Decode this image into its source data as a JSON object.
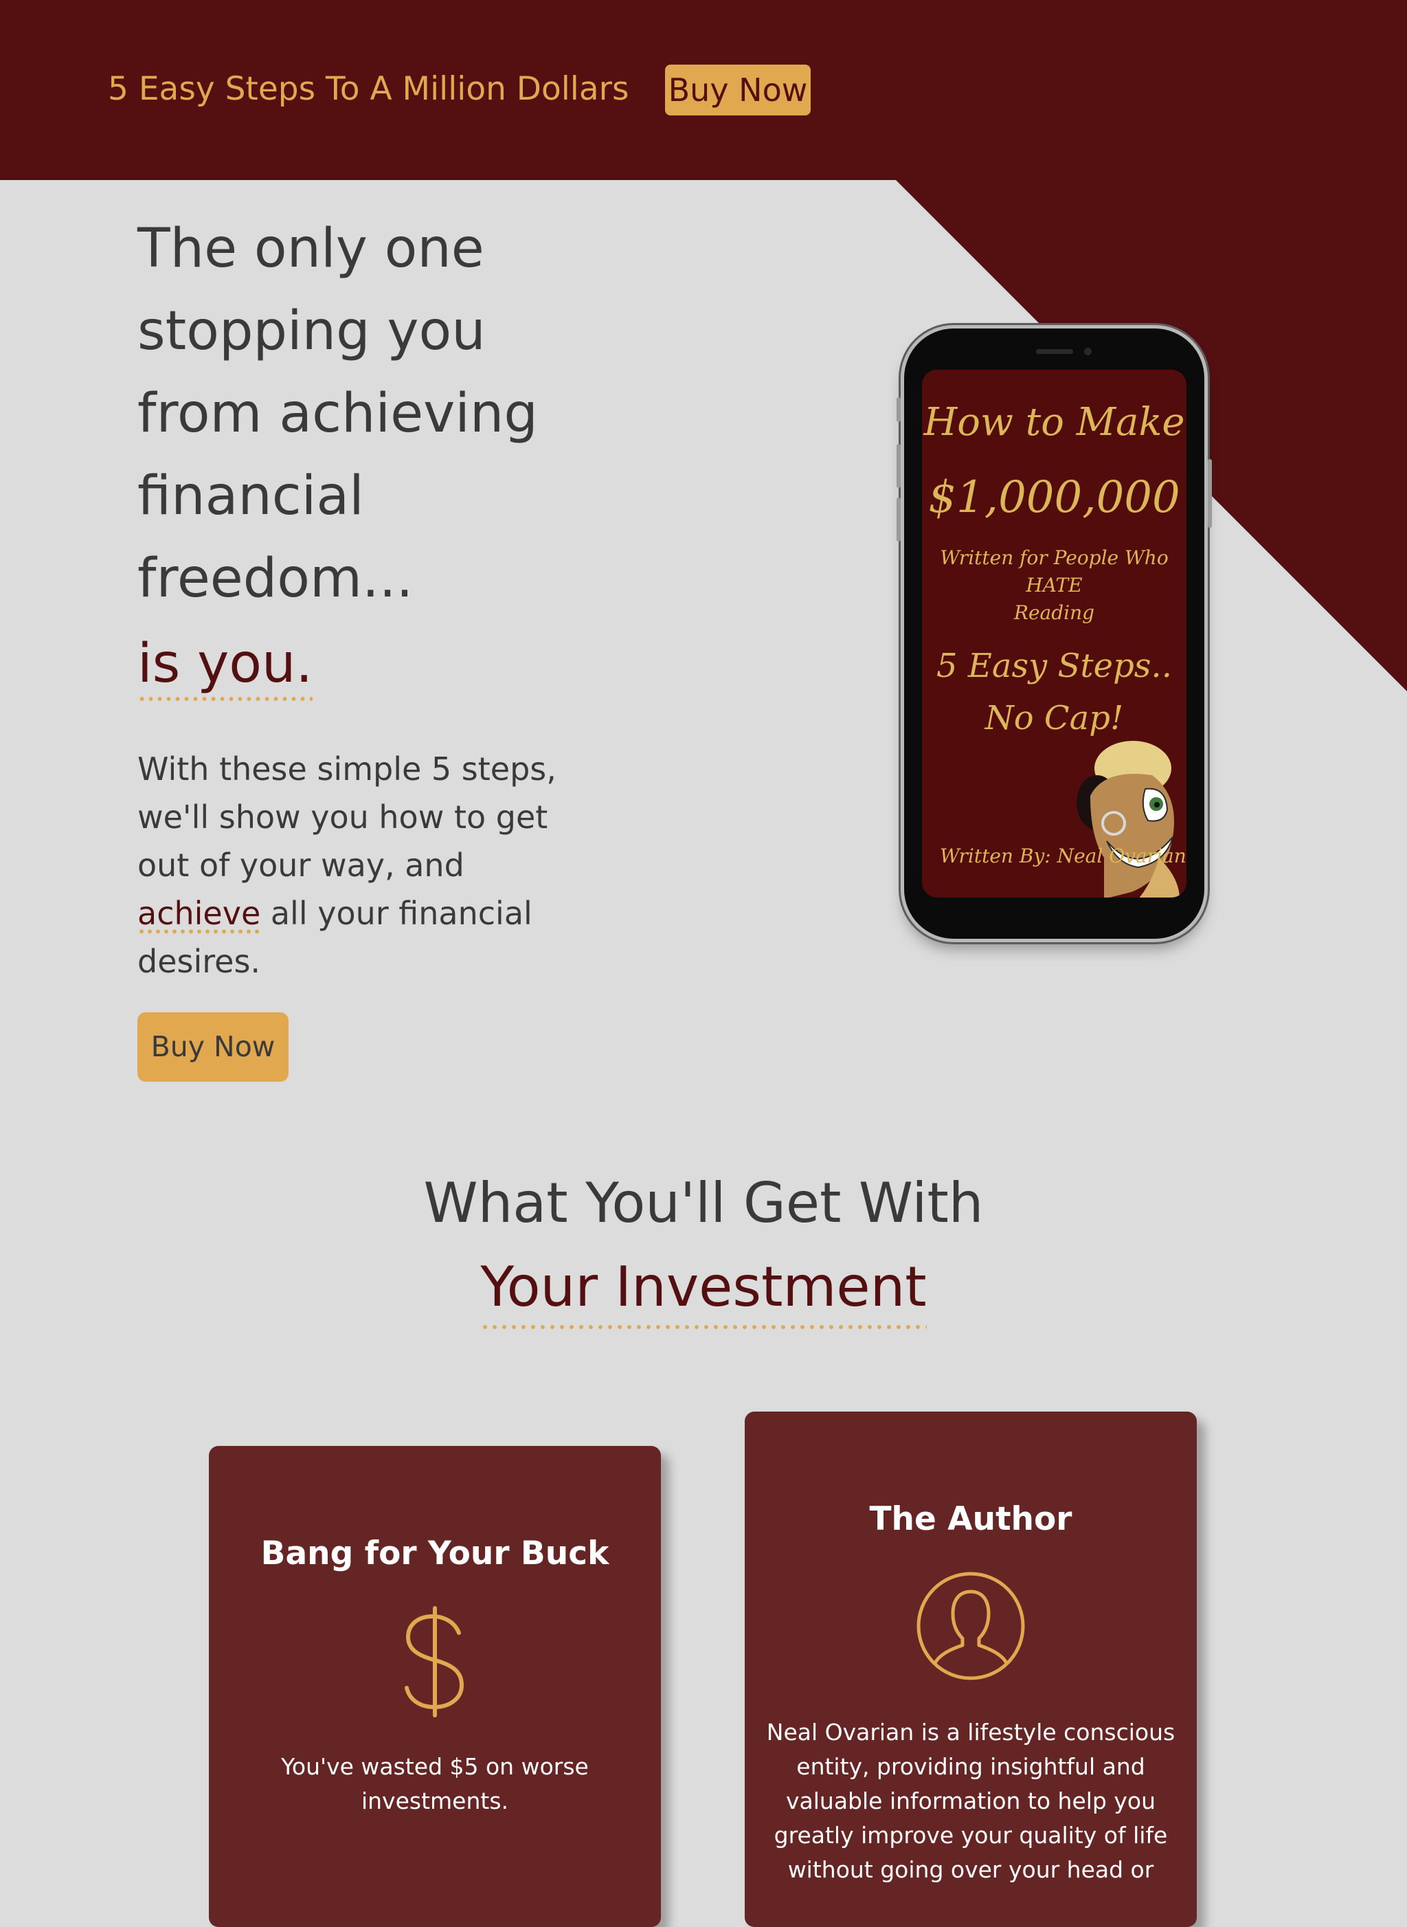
{
  "header": {
    "brand": "5 Easy Steps To A Million Dollars",
    "buy_label": "Buy Now"
  },
  "hero": {
    "title_lines": [
      "The only one",
      "stopping you",
      "from achieving",
      "financial",
      "freedom..."
    ],
    "title_accent": "is you.",
    "body": {
      "line1": "With these simple 5 steps,",
      "line2": "we'll show you how to get",
      "line3": "out of your way, and",
      "line4_accent": "achieve",
      "line4_rest": " all your financial",
      "line5": "desires."
    },
    "buy_label": "Buy Now"
  },
  "book_cover": {
    "title": "How to Make",
    "price": "$1,000,000",
    "subtitle_lines": [
      "Written for People Who",
      "HATE",
      "Reading"
    ],
    "steps_lines": [
      "5 Easy Steps..",
      "No Cap!"
    ],
    "author": "Written By: Neal Ovarian"
  },
  "section": {
    "title_line1": "What You'll Get With",
    "title_accent": "Your Investment"
  },
  "cards": [
    {
      "title": "Bang for Your Buck",
      "icon": "dollar-sign-icon",
      "text_lines": [
        "You've wasted $5 on worse",
        "investments."
      ]
    },
    {
      "title": "The Author",
      "icon": "person-icon",
      "text_lines": [
        "Neal Ovarian is a lifestyle conscious",
        "entity, providing insightful and",
        "valuable information to help you",
        "greatly improve your quality of life",
        "without going over your head or"
      ]
    }
  ],
  "colors": {
    "maroon": "#541010",
    "card": "#662525",
    "gold": "#e2a84f",
    "background": "#dcdcdc",
    "text": "#3a3a3a"
  }
}
